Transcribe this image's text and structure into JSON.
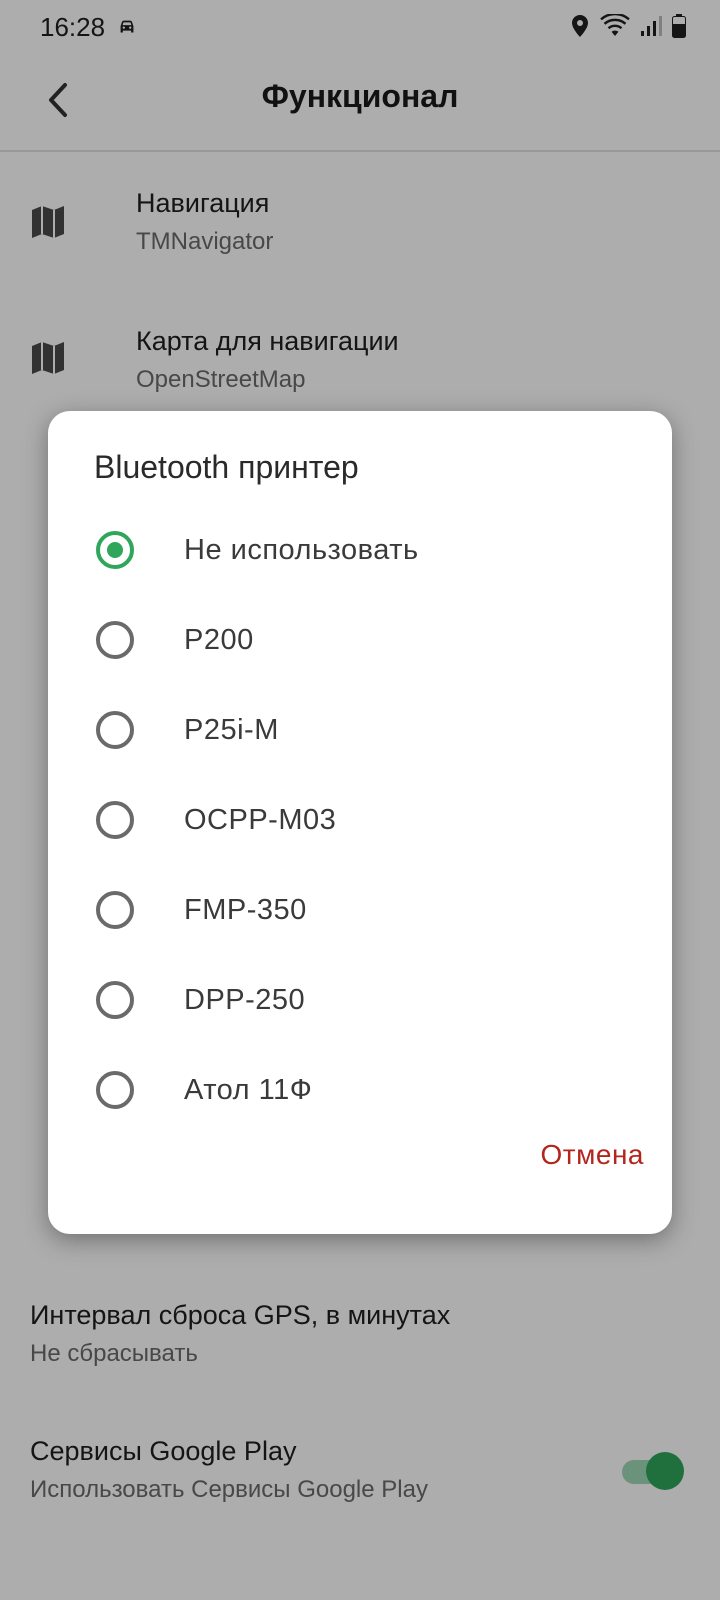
{
  "status_bar": {
    "time": "16:28",
    "icons": [
      "car-icon",
      "location-icon",
      "wifi-icon",
      "signal-icon",
      "battery-icon"
    ]
  },
  "app_bar": {
    "title": "Функционал"
  },
  "settings": {
    "navigation": {
      "title": "Навигация",
      "value": "TMNavigator"
    },
    "map": {
      "title": "Карта для навигации",
      "value": "OpenStreetMap"
    },
    "gps_reset": {
      "title": "Интервал сброса GPS, в минутах",
      "value": "Не сбрасывать"
    },
    "google_play": {
      "title": "Сервисы Google Play",
      "value": "Использовать Сервисы Google Play",
      "enabled": true
    }
  },
  "dialog": {
    "title": "Bluetooth принтер",
    "options": [
      {
        "label": "Не использовать",
        "selected": true
      },
      {
        "label": "P200",
        "selected": false
      },
      {
        "label": "P25i-M",
        "selected": false
      },
      {
        "label": "OCPP-M03",
        "selected": false
      },
      {
        "label": "FMP-350",
        "selected": false
      },
      {
        "label": "DPP-250",
        "selected": false
      },
      {
        "label": "Атол 11Ф",
        "selected": false
      }
    ],
    "cancel_label": "Отмена"
  },
  "colors": {
    "accent": "#2fa65b",
    "cancel": "#b3261e"
  }
}
